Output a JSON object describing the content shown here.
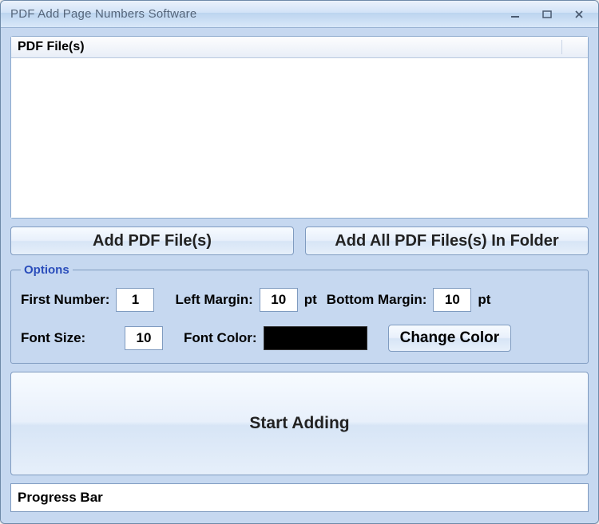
{
  "window": {
    "title": "PDF Add Page Numbers Software"
  },
  "list": {
    "header": "PDF File(s)"
  },
  "buttons": {
    "add_files": "Add PDF File(s)",
    "add_folder": "Add All PDF Files(s) In Folder",
    "change_color": "Change Color",
    "start": "Start Adding"
  },
  "options": {
    "legend": "Options",
    "first_number_label": "First Number:",
    "first_number_value": "1",
    "left_margin_label": "Left Margin:",
    "left_margin_value": "10",
    "left_margin_unit": "pt",
    "bottom_margin_label": "Bottom Margin:",
    "bottom_margin_value": "10",
    "bottom_margin_unit": "pt",
    "font_size_label": "Font Size:",
    "font_size_value": "10",
    "font_color_label": "Font Color:",
    "font_color_value": "#000000"
  },
  "progress": {
    "label": "Progress Bar"
  }
}
